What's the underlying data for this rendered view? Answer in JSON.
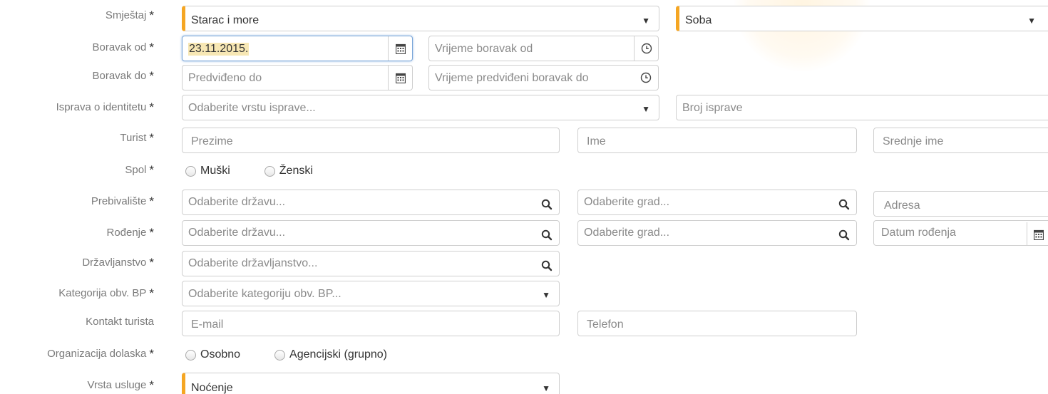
{
  "labels": {
    "smjestaj": "Smještaj",
    "boravak_od": "Boravak od",
    "boravak_do": "Boravak do",
    "isprava": "Isprava o identitetu",
    "turist": "Turist",
    "spol": "Spol",
    "prebivaliste": "Prebivalište",
    "rodenje": "Rođenje",
    "drzavljanstvo": "Državljanstvo",
    "kategorija": "Kategorija obv. BP",
    "kontakt": "Kontakt turista",
    "organizacija": "Organizacija dolaska",
    "vrsta_usluge": "Vrsta usluge",
    "required_mark": "*"
  },
  "smjestaj": {
    "object_value": "Starac i more",
    "unit_value": "Soba"
  },
  "boravak_od": {
    "date_value": "23.11.2015.",
    "time_placeholder": "Vrijeme boravak od"
  },
  "boravak_do": {
    "date_placeholder": "Predviđeno do",
    "time_placeholder": "Vrijeme predviđeni boravak do"
  },
  "isprava": {
    "type_placeholder": "Odaberite vrstu isprave...",
    "number_placeholder": "Broj isprave"
  },
  "turist": {
    "surname_placeholder": "Prezime",
    "name_placeholder": "Ime",
    "middle_placeholder": "Srednje ime"
  },
  "spol": {
    "options": [
      "Muški",
      "Ženski"
    ]
  },
  "prebivaliste": {
    "country_placeholder": "Odaberite državu...",
    "city_placeholder": "Odaberite grad...",
    "address_placeholder": "Adresa"
  },
  "rodenje": {
    "country_placeholder": "Odaberite državu...",
    "city_placeholder": "Odaberite grad...",
    "date_placeholder": "Datum rođenja"
  },
  "drzavljanstvo": {
    "placeholder": "Odaberite državljanstvo..."
  },
  "kategorija": {
    "placeholder": "Odaberite kategoriju obv. BP..."
  },
  "kontakt": {
    "email_placeholder": "E-mail",
    "phone_placeholder": "Telefon"
  },
  "organizacija": {
    "options": [
      "Osobno",
      "Agencijski (grupno)"
    ]
  },
  "vrsta_usluge": {
    "value": "Noćenje"
  },
  "glyphs": {
    "caret": "▼"
  },
  "colors": {
    "accent": "#f5a623",
    "focus": "#7aa6d8",
    "highlight": "#f7e7b4"
  },
  "icons": [
    "calendar-icon",
    "clock-icon",
    "search-icon",
    "chevron-down-icon"
  ]
}
